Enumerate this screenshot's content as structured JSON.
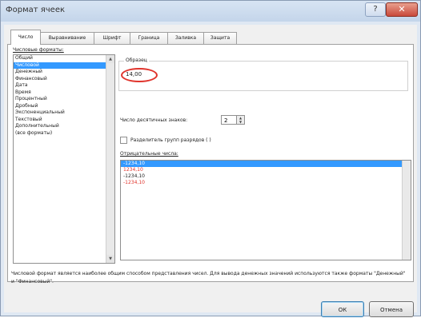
{
  "window": {
    "title": "Формат ячеек",
    "help_label": "?",
    "close_label": "✕"
  },
  "tabs": [
    {
      "label": "Число",
      "active": true
    },
    {
      "label": "Выравнивание",
      "active": false
    },
    {
      "label": "Шрифт",
      "active": false
    },
    {
      "label": "Граница",
      "active": false
    },
    {
      "label": "Заливка",
      "active": false
    },
    {
      "label": "Защита",
      "active": false
    }
  ],
  "number_formats": {
    "label": "Числовые форматы:",
    "items": [
      {
        "label": "Общий",
        "selected": false
      },
      {
        "label": "Числовой",
        "selected": true
      },
      {
        "label": "Денежный",
        "selected": false
      },
      {
        "label": "Финансовый",
        "selected": false
      },
      {
        "label": "Дата",
        "selected": false
      },
      {
        "label": "Время",
        "selected": false
      },
      {
        "label": "Процентный",
        "selected": false
      },
      {
        "label": "Дробный",
        "selected": false
      },
      {
        "label": "Экспоненциальный",
        "selected": false
      },
      {
        "label": "Текстовый",
        "selected": false
      },
      {
        "label": "Дополнительный",
        "selected": false
      },
      {
        "label": "(все форматы)",
        "selected": false
      }
    ]
  },
  "sample": {
    "label": "Образец",
    "value": "14,00"
  },
  "decimal_places": {
    "label": "Число десятичных знаков:",
    "value": "2"
  },
  "separator": {
    "label": "Разделитель групп разрядов ( )",
    "checked": false
  },
  "negative_numbers": {
    "label": "Отрицательные числа:",
    "items": [
      {
        "label": "-1234,10",
        "color": "#ffffff",
        "selected": true
      },
      {
        "label": "1234,10",
        "color": "#e0332b",
        "selected": false
      },
      {
        "label": "-1234,10",
        "color": "#222222",
        "selected": false
      },
      {
        "label": "-1234,10",
        "color": "#e0332b",
        "selected": false
      }
    ]
  },
  "description": "Числовой формат является наиболее общим способом представления чисел. Для вывода денежных значений используются также форматы \"Денежный\" и \"Финансовый\".",
  "buttons": {
    "ok": "ОК",
    "cancel": "Отмена"
  },
  "colors": {
    "selection": "#3399ff",
    "highlight_circle": "#e0332b",
    "negative_red": "#e0332b"
  }
}
